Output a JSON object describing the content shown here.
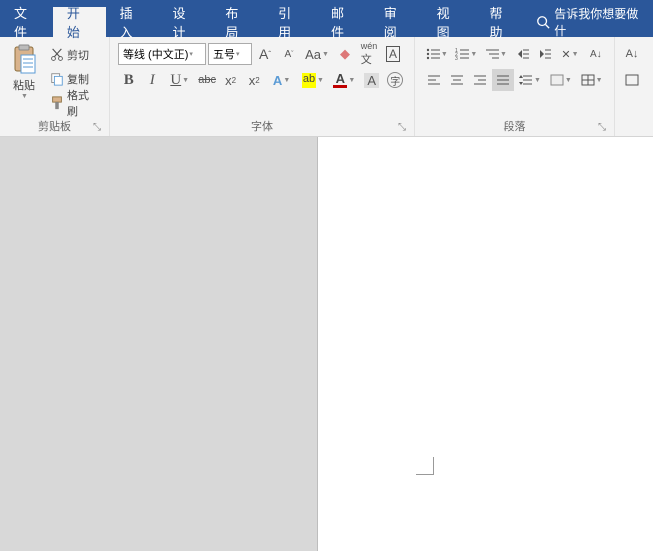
{
  "tabs": {
    "file": "文件",
    "home": "开始",
    "insert": "插入",
    "design": "设计",
    "layout": "布局",
    "references": "引用",
    "mailings": "邮件",
    "review": "审阅",
    "view": "视图",
    "help": "帮助"
  },
  "tell_me": "告诉我你想要做什",
  "clipboard": {
    "paste": "粘贴",
    "cut": "剪切",
    "copy": "复制",
    "format_painter": "格式刷",
    "group_label": "剪贴板"
  },
  "font": {
    "name": "等线 (中文正)",
    "size": "五号",
    "group_label": "字体"
  },
  "paragraph": {
    "group_label": "段落"
  }
}
